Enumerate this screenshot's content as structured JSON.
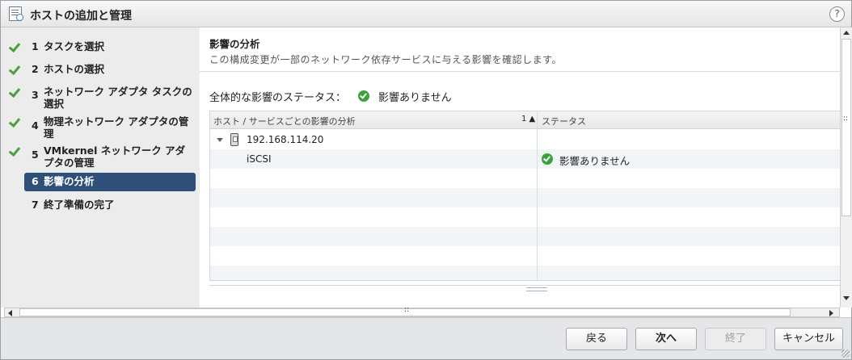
{
  "window": {
    "title": "ホストの追加と管理",
    "help": "?"
  },
  "steps": [
    {
      "num": "1",
      "label": "タスクを選択",
      "done": true
    },
    {
      "num": "2",
      "label": "ホストの選択",
      "done": true
    },
    {
      "num": "3",
      "label": "ネットワーク アダプタ タスクの選択",
      "done": true
    },
    {
      "num": "4",
      "label": "物理ネットワーク アダプタの管理",
      "done": true
    },
    {
      "num": "5",
      "label": "VMkernel ネットワーク アダプタの管理",
      "done": true
    },
    {
      "num": "6",
      "label": "影響の分析",
      "active": true
    },
    {
      "num": "7",
      "label": "終了準備の完了"
    }
  ],
  "main": {
    "title": "影響の分析",
    "description": "この構成変更が一部のネットワーク依存サービスに与える影響を確認します。",
    "overall_label": "全体的な影響のステータス：",
    "overall_value": "影響ありません"
  },
  "grid": {
    "col1": "ホスト / サービスごとの影響の分析",
    "sort": "1 ▲",
    "col2": "ステータス",
    "host": "192.168.114.20",
    "service": "iSCSI",
    "service_status": "影響ありません"
  },
  "footer": {
    "back": "戻る",
    "next": "次へ",
    "finish": "終了",
    "cancel": "キャンセル"
  },
  "colors": {
    "accent": "#2e4f78",
    "ok": "#3aa43a",
    "check": "#44a33a"
  }
}
